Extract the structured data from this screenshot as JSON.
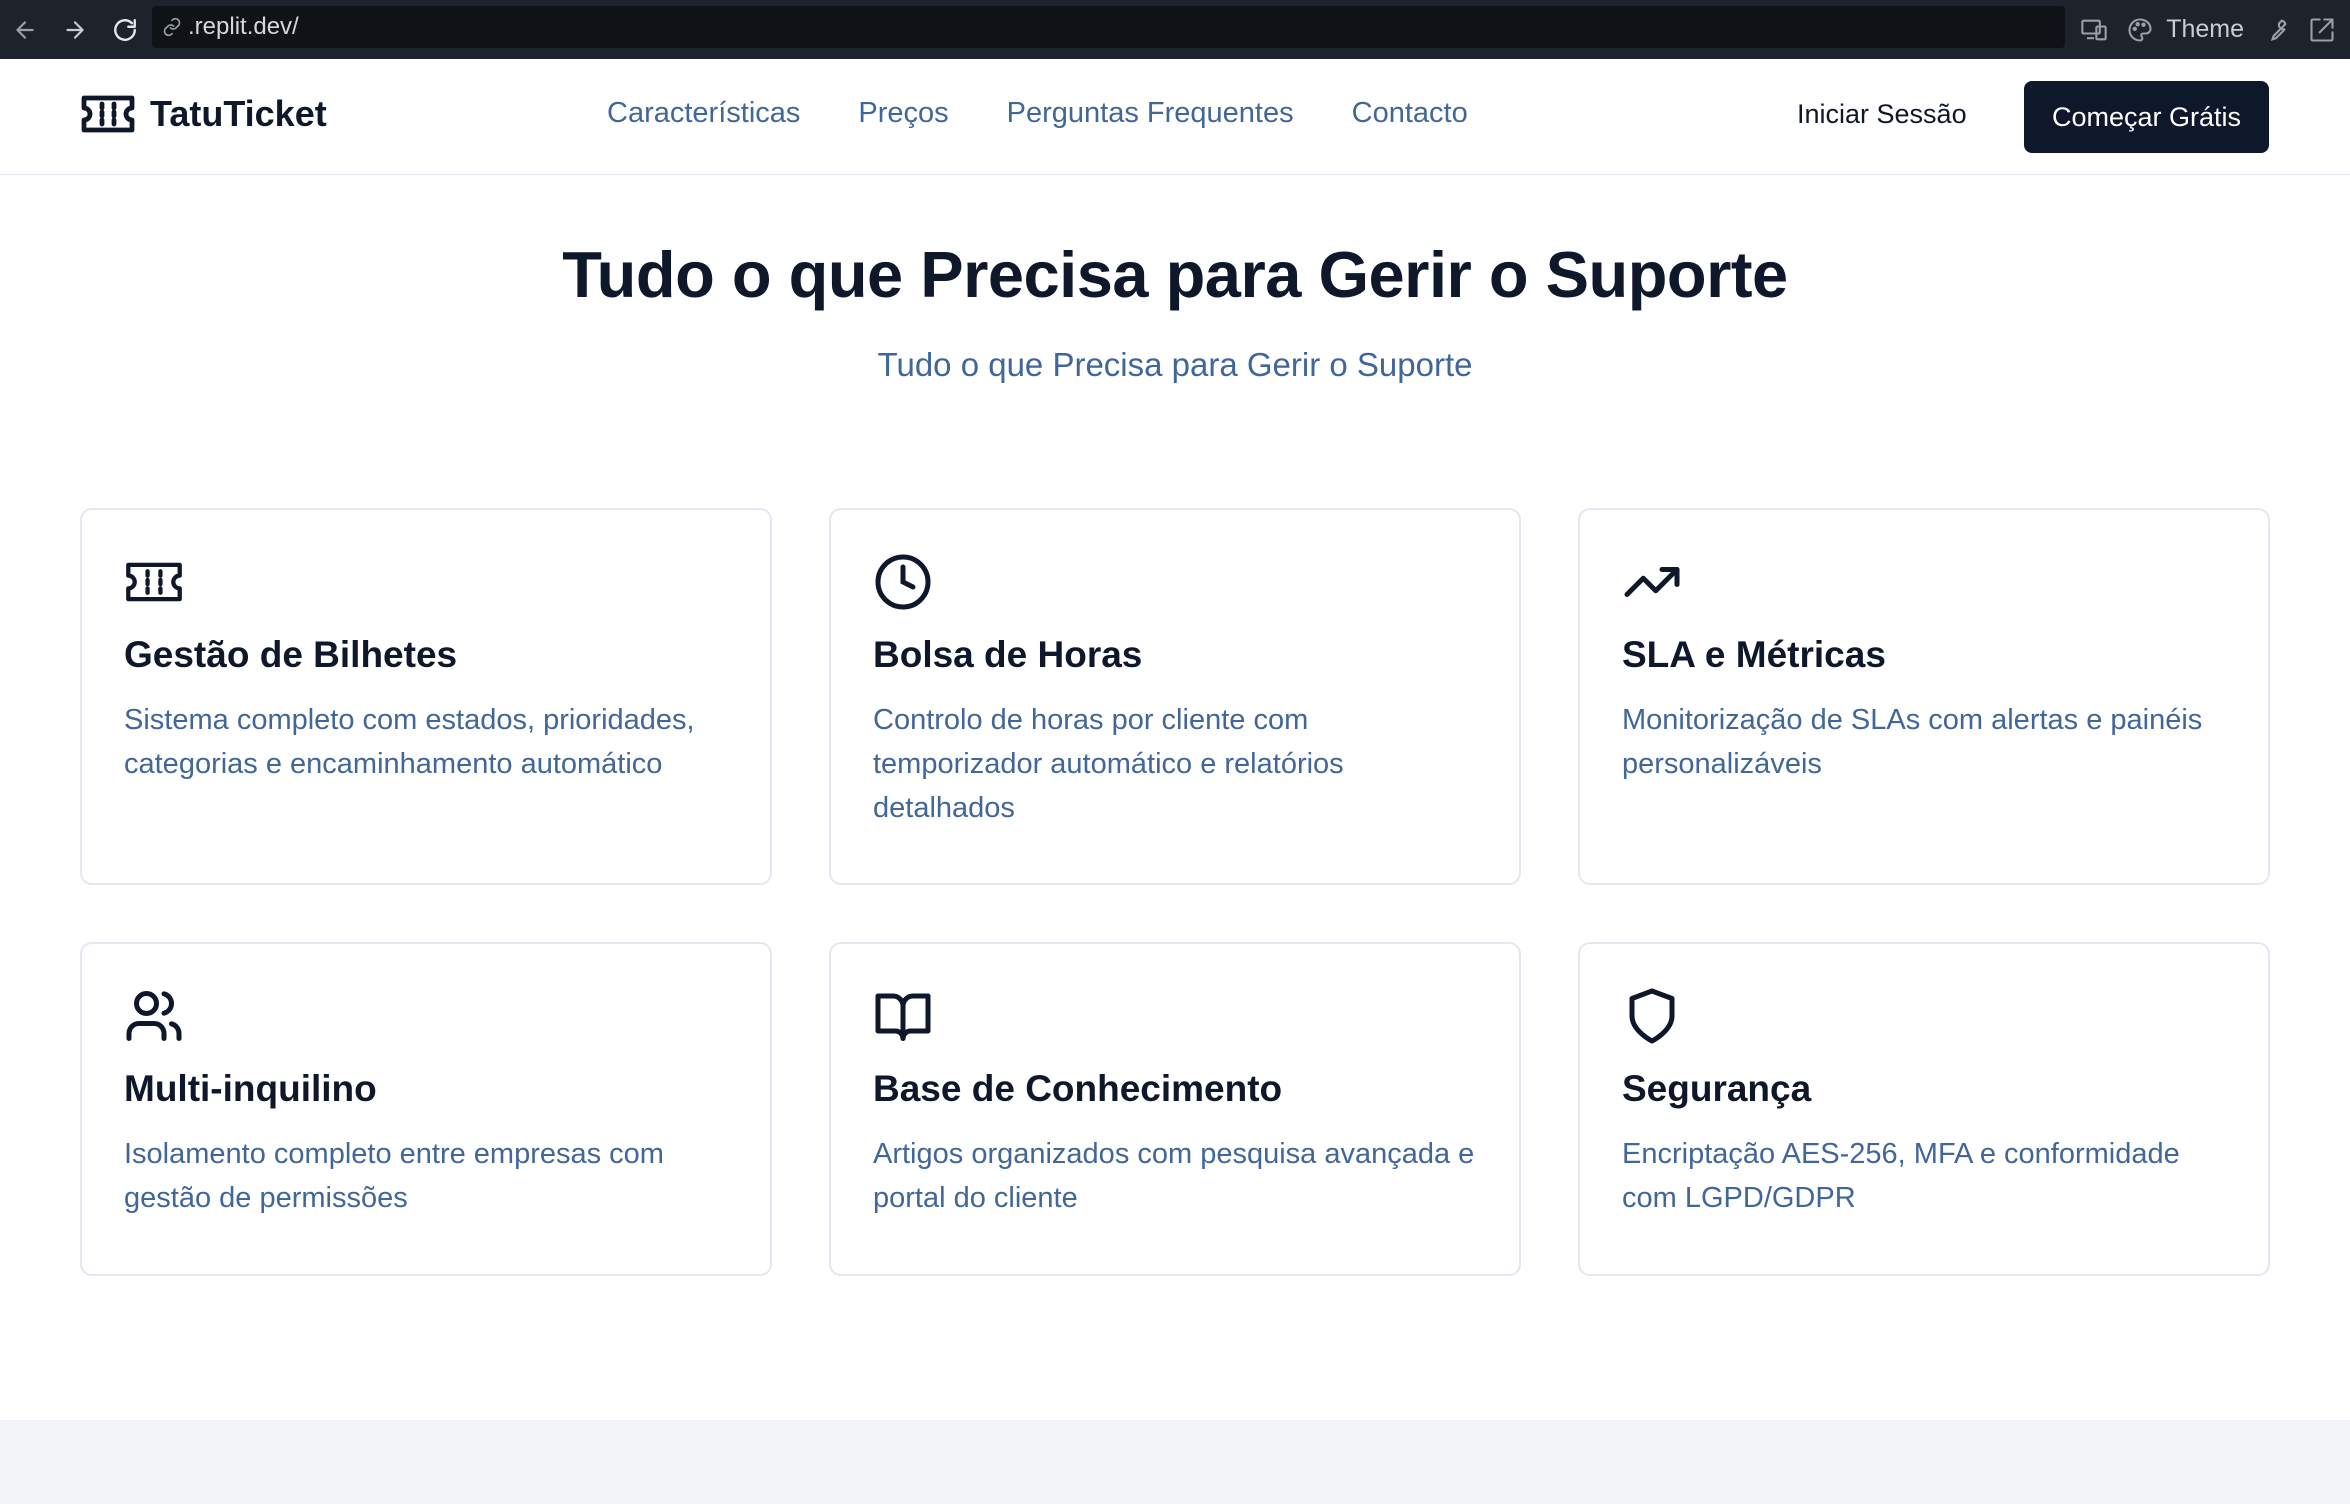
{
  "browser": {
    "url": ".replit.dev/",
    "theme_label": "Theme"
  },
  "header": {
    "brand": "TatuTicket",
    "nav": [
      "Características",
      "Preços",
      "Perguntas Frequentes",
      "Contacto"
    ],
    "login": "Iniciar Sessão",
    "cta": "Começar Grátis"
  },
  "hero": {
    "title": "Tudo o que Precisa para Gerir o Suporte",
    "subtitle": "Tudo o que Precisa para Gerir o Suporte"
  },
  "features": [
    {
      "icon": "ticket-icon",
      "title": "Gestão de Bilhetes",
      "description": "Sistema completo com estados, prioridades, categorias e encaminhamento automático"
    },
    {
      "icon": "clock-icon",
      "title": "Bolsa de Horas",
      "description": "Controlo de horas por cliente com temporizador automático e relatórios detalhados"
    },
    {
      "icon": "trending-up-icon",
      "title": "SLA e Métricas",
      "description": "Monitorização de SLAs com alertas e painéis personalizáveis"
    },
    {
      "icon": "users-icon",
      "title": "Multi-inquilino",
      "description": "Isolamento completo entre empresas com gestão de permissões"
    },
    {
      "icon": "book-open-icon",
      "title": "Base de Conhecimento",
      "description": "Artigos organizados com pesquisa avançada e portal do cliente"
    },
    {
      "icon": "shield-icon",
      "title": "Segurança",
      "description": "Encriptação AES-256, MFA e conformidade com LGPD/GDPR"
    }
  ]
}
